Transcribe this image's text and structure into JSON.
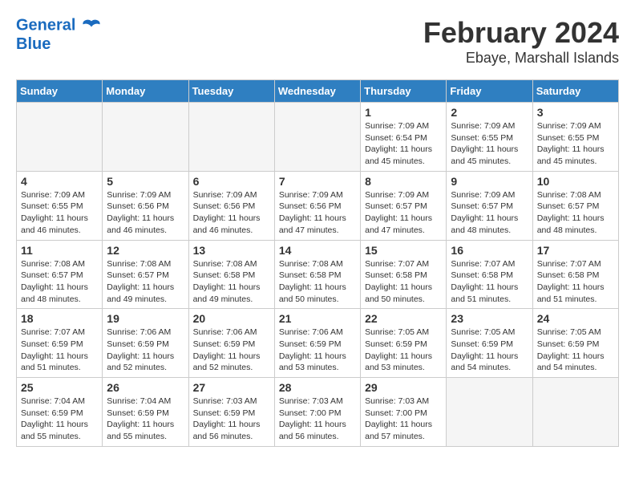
{
  "header": {
    "logo_line1": "General",
    "logo_line2": "Blue",
    "month": "February 2024",
    "location": "Ebaye, Marshall Islands"
  },
  "weekdays": [
    "Sunday",
    "Monday",
    "Tuesday",
    "Wednesday",
    "Thursday",
    "Friday",
    "Saturday"
  ],
  "weeks": [
    [
      {
        "day": "",
        "empty": true
      },
      {
        "day": "",
        "empty": true
      },
      {
        "day": "",
        "empty": true
      },
      {
        "day": "",
        "empty": true
      },
      {
        "day": "1",
        "sunrise": "7:09 AM",
        "sunset": "6:54 PM",
        "daylight": "11 hours and 45 minutes."
      },
      {
        "day": "2",
        "sunrise": "7:09 AM",
        "sunset": "6:55 PM",
        "daylight": "11 hours and 45 minutes."
      },
      {
        "day": "3",
        "sunrise": "7:09 AM",
        "sunset": "6:55 PM",
        "daylight": "11 hours and 45 minutes."
      }
    ],
    [
      {
        "day": "4",
        "sunrise": "7:09 AM",
        "sunset": "6:55 PM",
        "daylight": "11 hours and 46 minutes."
      },
      {
        "day": "5",
        "sunrise": "7:09 AM",
        "sunset": "6:56 PM",
        "daylight": "11 hours and 46 minutes."
      },
      {
        "day": "6",
        "sunrise": "7:09 AM",
        "sunset": "6:56 PM",
        "daylight": "11 hours and 46 minutes."
      },
      {
        "day": "7",
        "sunrise": "7:09 AM",
        "sunset": "6:56 PM",
        "daylight": "11 hours and 47 minutes."
      },
      {
        "day": "8",
        "sunrise": "7:09 AM",
        "sunset": "6:57 PM",
        "daylight": "11 hours and 47 minutes."
      },
      {
        "day": "9",
        "sunrise": "7:09 AM",
        "sunset": "6:57 PM",
        "daylight": "11 hours and 48 minutes."
      },
      {
        "day": "10",
        "sunrise": "7:08 AM",
        "sunset": "6:57 PM",
        "daylight": "11 hours and 48 minutes."
      }
    ],
    [
      {
        "day": "11",
        "sunrise": "7:08 AM",
        "sunset": "6:57 PM",
        "daylight": "11 hours and 48 minutes."
      },
      {
        "day": "12",
        "sunrise": "7:08 AM",
        "sunset": "6:57 PM",
        "daylight": "11 hours and 49 minutes."
      },
      {
        "day": "13",
        "sunrise": "7:08 AM",
        "sunset": "6:58 PM",
        "daylight": "11 hours and 49 minutes."
      },
      {
        "day": "14",
        "sunrise": "7:08 AM",
        "sunset": "6:58 PM",
        "daylight": "11 hours and 50 minutes."
      },
      {
        "day": "15",
        "sunrise": "7:07 AM",
        "sunset": "6:58 PM",
        "daylight": "11 hours and 50 minutes."
      },
      {
        "day": "16",
        "sunrise": "7:07 AM",
        "sunset": "6:58 PM",
        "daylight": "11 hours and 51 minutes."
      },
      {
        "day": "17",
        "sunrise": "7:07 AM",
        "sunset": "6:58 PM",
        "daylight": "11 hours and 51 minutes."
      }
    ],
    [
      {
        "day": "18",
        "sunrise": "7:07 AM",
        "sunset": "6:59 PM",
        "daylight": "11 hours and 51 minutes."
      },
      {
        "day": "19",
        "sunrise": "7:06 AM",
        "sunset": "6:59 PM",
        "daylight": "11 hours and 52 minutes."
      },
      {
        "day": "20",
        "sunrise": "7:06 AM",
        "sunset": "6:59 PM",
        "daylight": "11 hours and 52 minutes."
      },
      {
        "day": "21",
        "sunrise": "7:06 AM",
        "sunset": "6:59 PM",
        "daylight": "11 hours and 53 minutes."
      },
      {
        "day": "22",
        "sunrise": "7:05 AM",
        "sunset": "6:59 PM",
        "daylight": "11 hours and 53 minutes."
      },
      {
        "day": "23",
        "sunrise": "7:05 AM",
        "sunset": "6:59 PM",
        "daylight": "11 hours and 54 minutes."
      },
      {
        "day": "24",
        "sunrise": "7:05 AM",
        "sunset": "6:59 PM",
        "daylight": "11 hours and 54 minutes."
      }
    ],
    [
      {
        "day": "25",
        "sunrise": "7:04 AM",
        "sunset": "6:59 PM",
        "daylight": "11 hours and 55 minutes."
      },
      {
        "day": "26",
        "sunrise": "7:04 AM",
        "sunset": "6:59 PM",
        "daylight": "11 hours and 55 minutes."
      },
      {
        "day": "27",
        "sunrise": "7:03 AM",
        "sunset": "6:59 PM",
        "daylight": "11 hours and 56 minutes."
      },
      {
        "day": "28",
        "sunrise": "7:03 AM",
        "sunset": "7:00 PM",
        "daylight": "11 hours and 56 minutes."
      },
      {
        "day": "29",
        "sunrise": "7:03 AM",
        "sunset": "7:00 PM",
        "daylight": "11 hours and 57 minutes."
      },
      {
        "day": "",
        "empty": true
      },
      {
        "day": "",
        "empty": true
      }
    ]
  ]
}
